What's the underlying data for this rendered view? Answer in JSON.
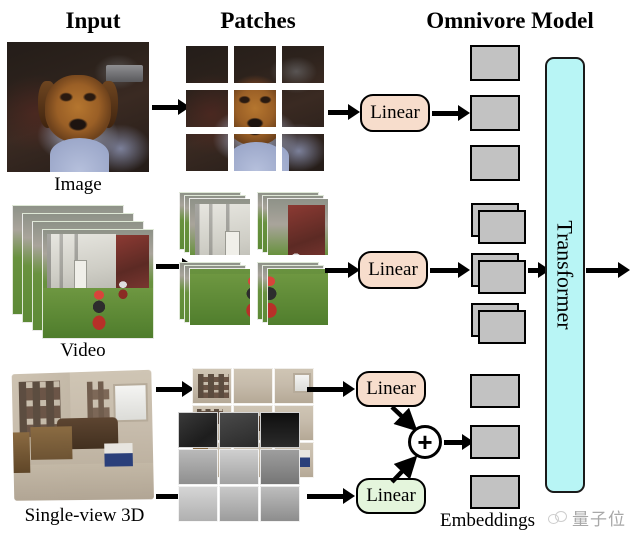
{
  "figure": {
    "title": "Omnivore model architecture overview",
    "headers": [
      {
        "key": "input",
        "label": "Input"
      },
      {
        "key": "patches",
        "label": "Patches"
      },
      {
        "key": "model",
        "label": "Omnivore Model"
      }
    ],
    "row_labels": [
      {
        "key": "image",
        "label": "Image"
      },
      {
        "key": "video",
        "label": "Video"
      },
      {
        "key": "sv3d",
        "label": "Single-view 3D"
      }
    ],
    "embeddings_label": "Embeddings",
    "transformer_label": "Transformer",
    "linear_label": "Linear",
    "plus_symbol": "+",
    "colors": {
      "linear_rgb": "#f7ddcc",
      "linear_depth": "#e4f5dc",
      "transformer": "#b8f5f5",
      "embedding": "#c2c2c2",
      "stroke": "#000000",
      "background": "#ffffff"
    },
    "modalities": [
      {
        "name": "Image",
        "patch_layout": "3x3",
        "patch_count": 9,
        "stacked_frames": 1,
        "projections": [
          "Linear"
        ],
        "embedding_tokens": 3,
        "embedding_stacked": false
      },
      {
        "name": "Video",
        "patch_layout": "2x2",
        "patch_count": 4,
        "stacked_frames": 4,
        "projections": [
          "Linear"
        ],
        "embedding_tokens": 3,
        "embedding_stacked": true
      },
      {
        "name": "Single-view 3D",
        "patch_layout": "3x3 RGB + 3x3 depth",
        "patch_count": 18,
        "stacked_frames": 1,
        "projections": [
          "Linear",
          "Linear"
        ],
        "fusion": "+",
        "embedding_tokens": 3,
        "embedding_stacked": false
      }
    ]
  },
  "watermark": {
    "text": "量子位",
    "logo_icon": "qbitai-logo-icon"
  }
}
